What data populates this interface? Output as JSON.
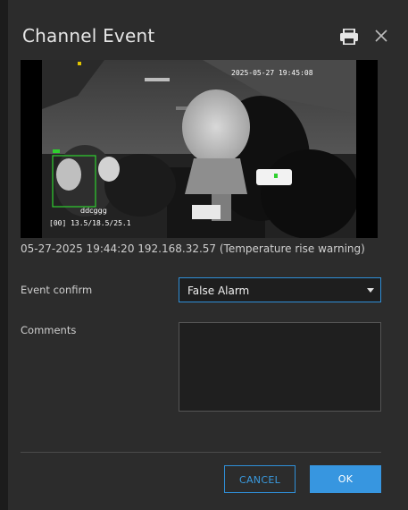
{
  "dialog": {
    "title": "Channel Event",
    "icons": {
      "print": "printer-icon",
      "close": "close-icon"
    }
  },
  "video": {
    "osd_timestamp": "2025-05-27 19:45:08",
    "detection_label": "ddcggg",
    "detection_sublabel": "[00] 13.5/18.5/25.1",
    "bbox_color": "#2fd02f"
  },
  "event": {
    "info": "05-27-2025 19:44:20  192.168.32.57  (Temperature rise warning)"
  },
  "form": {
    "event_confirm_label": "Event confirm",
    "event_confirm_value": "False Alarm",
    "comments_label": "Comments",
    "comments_value": ""
  },
  "buttons": {
    "cancel": "CANCEL",
    "ok": "OK"
  },
  "colors": {
    "accent": "#3796e0",
    "background": "#2c2c2c"
  }
}
